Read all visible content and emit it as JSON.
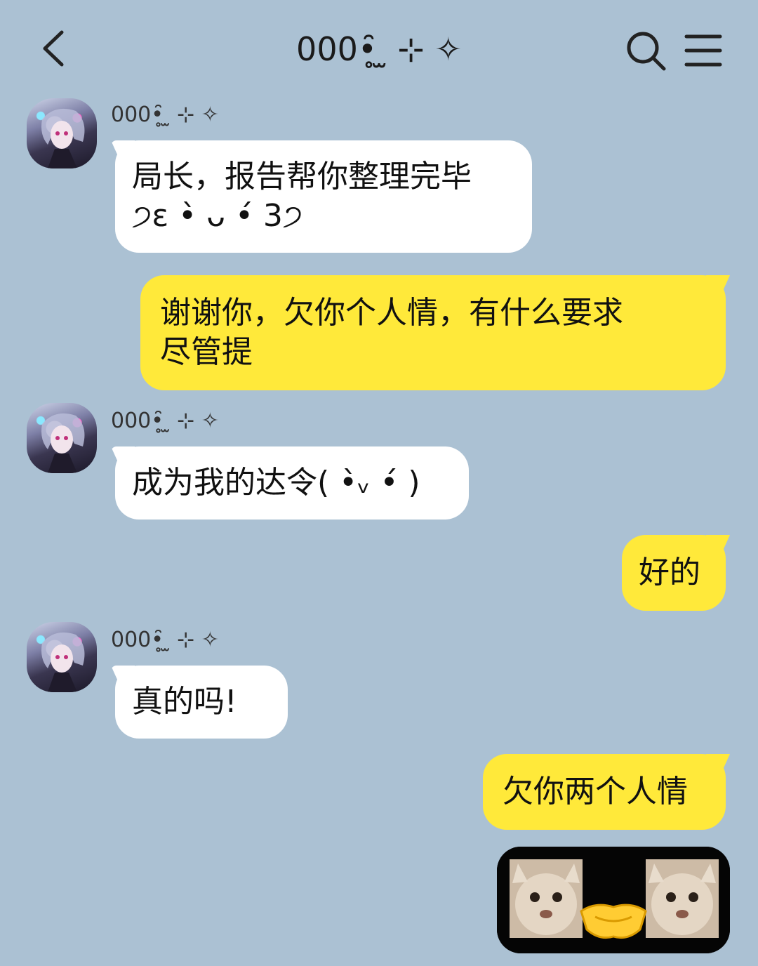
{
  "header": {
    "title": "000•̥̑ ̫ ⊹ ✧",
    "back_icon": "chevron-left-icon",
    "search_icon": "search-icon",
    "menu_icon": "hamburger-menu-icon"
  },
  "messages": [
    {
      "side": "in",
      "sender": "000•̥̑ ̫ ⊹ ✧",
      "text": "局长，报告帮你整理完毕\n੭ɛ •̀ ᴗ •́ 3੭"
    },
    {
      "side": "out",
      "text": "谢谢你，欠你个人情，有什么要求\n尽管提"
    },
    {
      "side": "in",
      "sender": "000•̥̑ ̫ ⊹ ✧",
      "text": "成为我的达令( •̀ᵥ •́ )"
    },
    {
      "side": "out",
      "text": "好的"
    },
    {
      "side": "in",
      "sender": "000•̥̑ ̫ ⊹ ✧",
      "text": "真的吗!"
    },
    {
      "side": "out",
      "text": "欠你两个人情"
    }
  ],
  "sticker": {
    "icon": "cat-handshake-sticker"
  },
  "colors": {
    "background": "#abc1d3",
    "incoming_bubble": "#ffffff",
    "outgoing_bubble": "#ffe93a"
  }
}
